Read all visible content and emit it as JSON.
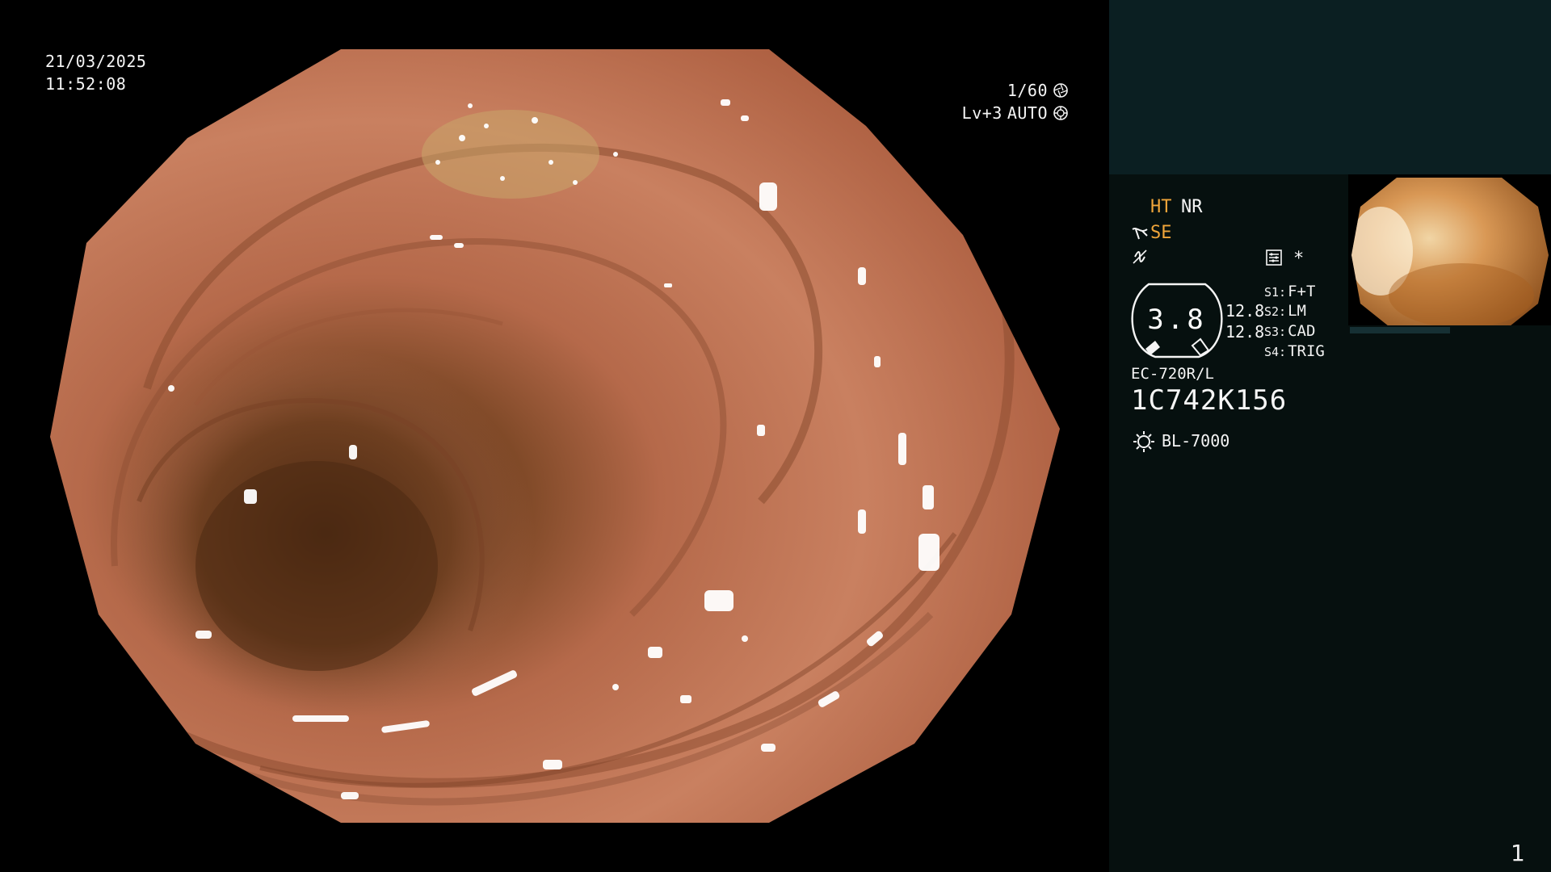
{
  "overlay": {
    "date": "21/03/2025",
    "time": "11:52:08",
    "shutter": "1/60",
    "level": "Lv+3",
    "exposure_mode": "AUTO",
    "shutter_icon": "aperture-icon",
    "exposure_icon": "iris-icon"
  },
  "panel": {
    "mode_ht": "HT",
    "mode_nr": "NR",
    "mode_se": "SE",
    "asterisk": "*",
    "gauge_value": "3.8",
    "value_top": "12.8",
    "value_bottom": "12.8",
    "slots": [
      {
        "key": "S1:",
        "value": "F+T"
      },
      {
        "key": "S2:",
        "value": "LM"
      },
      {
        "key": "S3:",
        "value": "CAD"
      },
      {
        "key": "S4:",
        "value": "TRIG"
      }
    ],
    "scope_model": "EC-720R/L",
    "scope_serial": "1C742K156",
    "light_source": "BL-7000",
    "page_number": "1",
    "colors": {
      "accent": "#f0a53a",
      "panel_bg": "#06100f",
      "panel_top_bg": "#0b1f22",
      "text": "#f5f5f5"
    }
  }
}
